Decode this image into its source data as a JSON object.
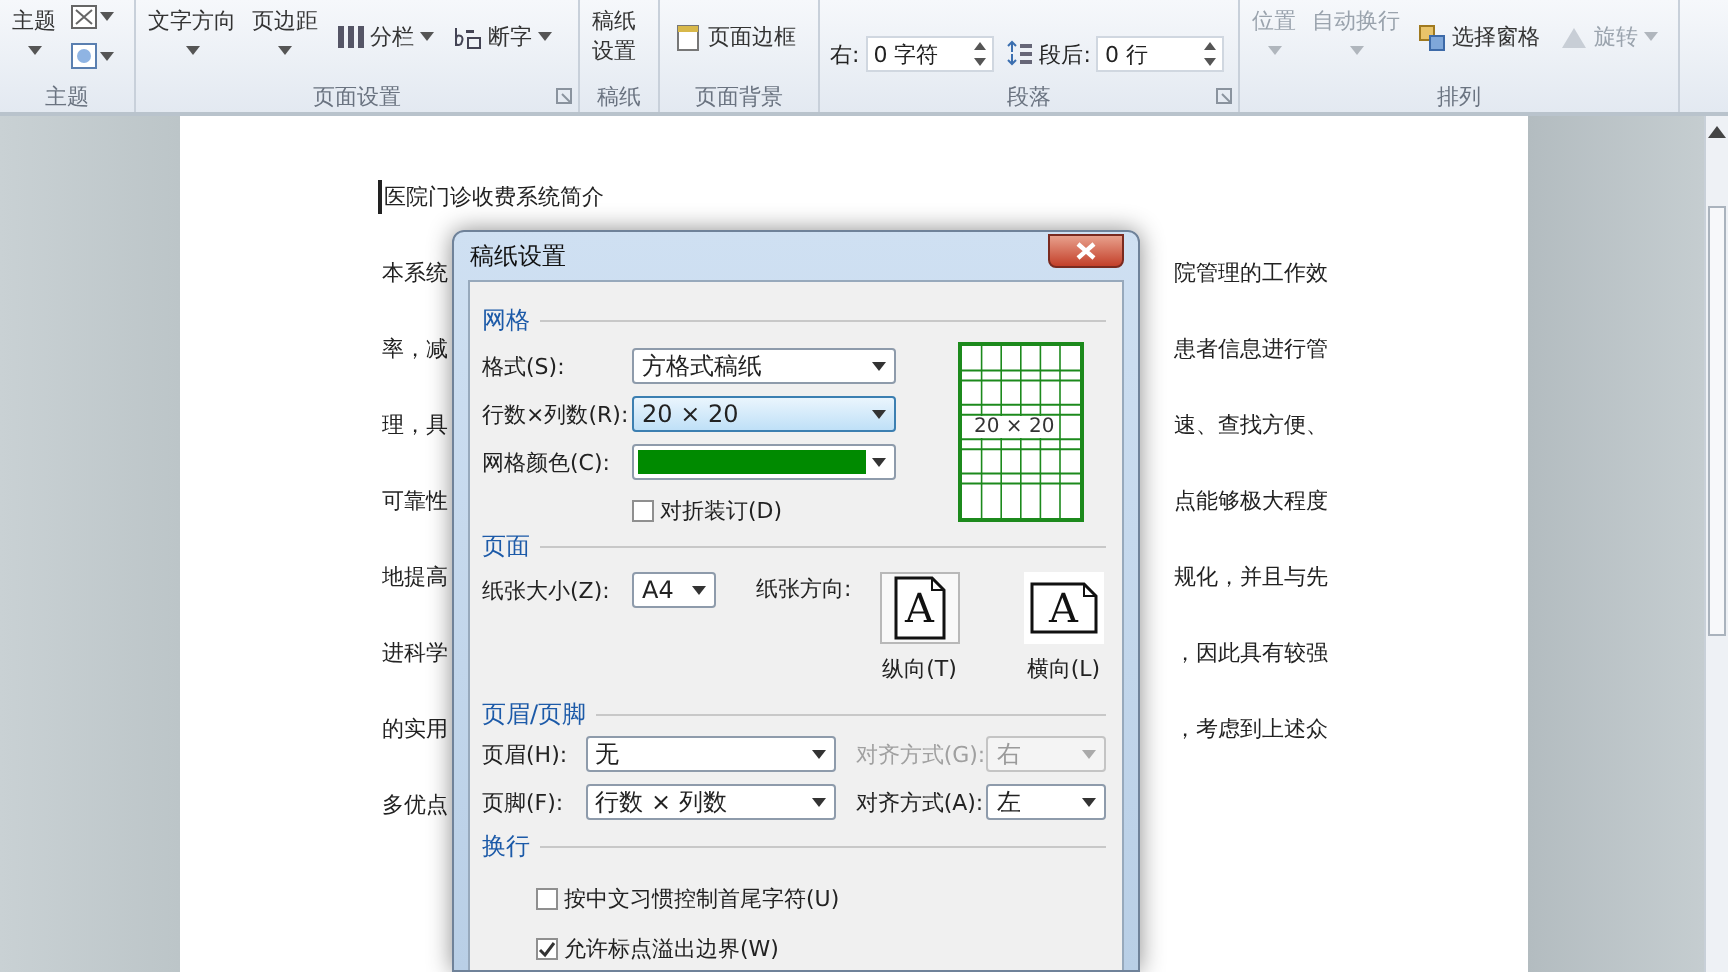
{
  "ribbon": {
    "groups": [
      {
        "label": "主题",
        "launcher": false,
        "items": [
          {
            "kind": "big",
            "label": "主题"
          },
          {
            "kind": "icon-menu"
          }
        ]
      },
      {
        "label": "页面设置",
        "launcher": true,
        "items": [
          {
            "kind": "big",
            "label": "文字方向"
          },
          {
            "kind": "big",
            "label": "页边距"
          },
          {
            "kind": "columns",
            "label": "分栏"
          },
          {
            "kind": "hyphenation",
            "label": "断字"
          }
        ]
      },
      {
        "label": "稿纸",
        "launcher": false,
        "items": [
          {
            "kind": "tall",
            "label": "稿纸设置"
          }
        ]
      },
      {
        "label": "页面背景",
        "launcher": false,
        "items": [
          {
            "kind": "page-border",
            "label": "页面边框"
          }
        ]
      },
      {
        "label": "段落",
        "launcher": true,
        "items": [
          {
            "kind": "spin",
            "label": "右:",
            "value": "0 字符"
          },
          {
            "kind": "spin-spacing",
            "label": "段后:",
            "value": "0 行"
          }
        ]
      },
      {
        "label": "排列",
        "launcher": false,
        "items": [
          {
            "kind": "big",
            "label": "位置",
            "disabled": true
          },
          {
            "kind": "big",
            "label": "自动换行",
            "disabled": true
          },
          {
            "kind": "selection-pane",
            "label": "选择窗格",
            "disabled": false
          },
          {
            "kind": "rotate",
            "label": "旋转",
            "disabled": true
          }
        ]
      }
    ]
  },
  "document": {
    "title": "医院门诊收费系统简介",
    "lines": [
      {
        "left": "本系统",
        "right": "院管理的工作效"
      },
      {
        "left": "率，减",
        "right": "患者信息进行管"
      },
      {
        "left": "理，具",
        "right": "速、查找方便、"
      },
      {
        "left": "可靠性",
        "right": "点能够极大程度"
      },
      {
        "left": "地提高",
        "right": "规化，并且与先"
      },
      {
        "left": "进科学",
        "right": "，因此具有较强"
      },
      {
        "left": "的实用",
        "right": "，考虑到上述众"
      },
      {
        "left": "多优点"
      }
    ]
  },
  "dialog": {
    "title": "稿纸设置",
    "grid": {
      "heading": "网格",
      "format": {
        "label": "格式(S):",
        "value": "方格式稿纸"
      },
      "size": {
        "label": "行数×列数(R):",
        "value": "20 × 20",
        "highlighted": true
      },
      "grid_color": {
        "label": "网格颜色(C):",
        "color": "#008a00"
      },
      "fold": {
        "label": "对折装订(D)",
        "checked": false
      },
      "preview": {
        "text": "20 × 20"
      }
    },
    "page": {
      "heading": "页面",
      "paper_size": {
        "label": "纸张大小(Z):",
        "value": "A4"
      },
      "orientation": {
        "label": "纸张方向:",
        "options": [
          {
            "glyph": "A",
            "label": "纵向(T)",
            "kind": "portrait",
            "selected": true
          },
          {
            "glyph": "A",
            "label": "横向(L)",
            "kind": "landscape",
            "selected": false
          }
        ]
      }
    },
    "header_footer": {
      "heading": "页眉/页脚",
      "rows": [
        {
          "label": "页眉(H):",
          "value": "无",
          "align_label": "对齐方式(G):",
          "align_value": "右",
          "align_disabled": true
        },
        {
          "label": "页脚(F):",
          "value": "行数 × 列数",
          "align_label": "对齐方式(A):",
          "align_value": "左",
          "align_disabled": false
        }
      ]
    },
    "wrap": {
      "heading": "换行",
      "options": [
        {
          "label": "按中文习惯控制首尾字符(U)",
          "checked": false
        },
        {
          "label": "允许标点溢出边界(W)",
          "checked": true
        }
      ]
    }
  }
}
